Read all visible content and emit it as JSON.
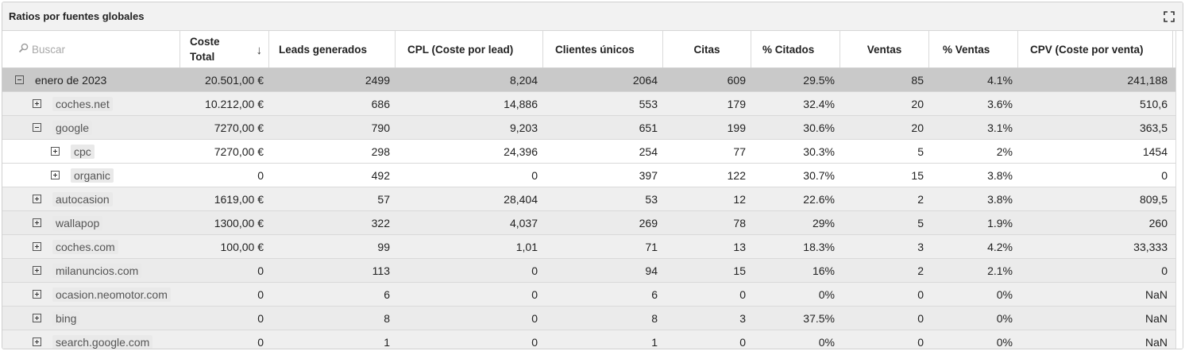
{
  "panel": {
    "title": "Ratios por fuentes globales"
  },
  "search": {
    "placeholder": "Buscar"
  },
  "columns": [
    {
      "label": "Coste Total",
      "line1": "Coste",
      "line2": "Total"
    },
    {
      "label": "Leads generados"
    },
    {
      "label": "CPL (Coste por lead)"
    },
    {
      "label": "Clientes únicos"
    },
    {
      "label": "Citas"
    },
    {
      "label": "% Citados"
    },
    {
      "label": "Ventas"
    },
    {
      "label": "% Ventas"
    },
    {
      "label": "CPV (Coste por venta)"
    }
  ],
  "sort_arrow": "↓",
  "rows": [
    {
      "level": 0,
      "expanded": true,
      "name": "enero de 2023",
      "values": [
        "20.501,00 €",
        "2499",
        "8,204",
        "2064",
        "609",
        "29.5%",
        "85",
        "4.1%",
        "241,188"
      ]
    },
    {
      "level": 1,
      "expanded": false,
      "name": "coches.net",
      "values": [
        "10.212,00 €",
        "686",
        "14,886",
        "553",
        "179",
        "32.4%",
        "20",
        "3.6%",
        "510,6"
      ]
    },
    {
      "level": 1,
      "expanded": true,
      "name": "google",
      "values": [
        "7270,00 €",
        "790",
        "9,203",
        "651",
        "199",
        "30.6%",
        "20",
        "3.1%",
        "363,5"
      ]
    },
    {
      "level": 2,
      "expanded": false,
      "name": "cpc",
      "values": [
        "7270,00 €",
        "298",
        "24,396",
        "254",
        "77",
        "30.3%",
        "5",
        "2%",
        "1454"
      ]
    },
    {
      "level": 2,
      "expanded": false,
      "name": "organic",
      "values": [
        "0",
        "492",
        "0",
        "397",
        "122",
        "30.7%",
        "15",
        "3.8%",
        "0"
      ]
    },
    {
      "level": 1,
      "expanded": false,
      "name": "autocasion",
      "values": [
        "1619,00 €",
        "57",
        "28,404",
        "53",
        "12",
        "22.6%",
        "2",
        "3.8%",
        "809,5"
      ]
    },
    {
      "level": 1,
      "expanded": false,
      "name": "wallapop",
      "values": [
        "1300,00 €",
        "322",
        "4,037",
        "269",
        "78",
        "29%",
        "5",
        "1.9%",
        "260"
      ]
    },
    {
      "level": 1,
      "expanded": false,
      "name": "coches.com",
      "values": [
        "100,00 €",
        "99",
        "1,01",
        "71",
        "13",
        "18.3%",
        "3",
        "4.2%",
        "33,333"
      ]
    },
    {
      "level": 1,
      "expanded": false,
      "name": "milanuncios.com",
      "values": [
        "0",
        "113",
        "0",
        "94",
        "15",
        "16%",
        "2",
        "2.1%",
        "0"
      ]
    },
    {
      "level": 1,
      "expanded": false,
      "name": "ocasion.neomotor.com",
      "values": [
        "0",
        "6",
        "0",
        "6",
        "0",
        "0%",
        "0",
        "0%",
        "NaN"
      ]
    },
    {
      "level": 1,
      "expanded": false,
      "name": "bing",
      "values": [
        "0",
        "8",
        "0",
        "8",
        "3",
        "37.5%",
        "0",
        "0%",
        "NaN"
      ]
    },
    {
      "level": 1,
      "expanded": false,
      "name": "search.google.com",
      "values": [
        "0",
        "1",
        "0",
        "1",
        "0",
        "0%",
        "0",
        "0%",
        "NaN"
      ]
    }
  ]
}
